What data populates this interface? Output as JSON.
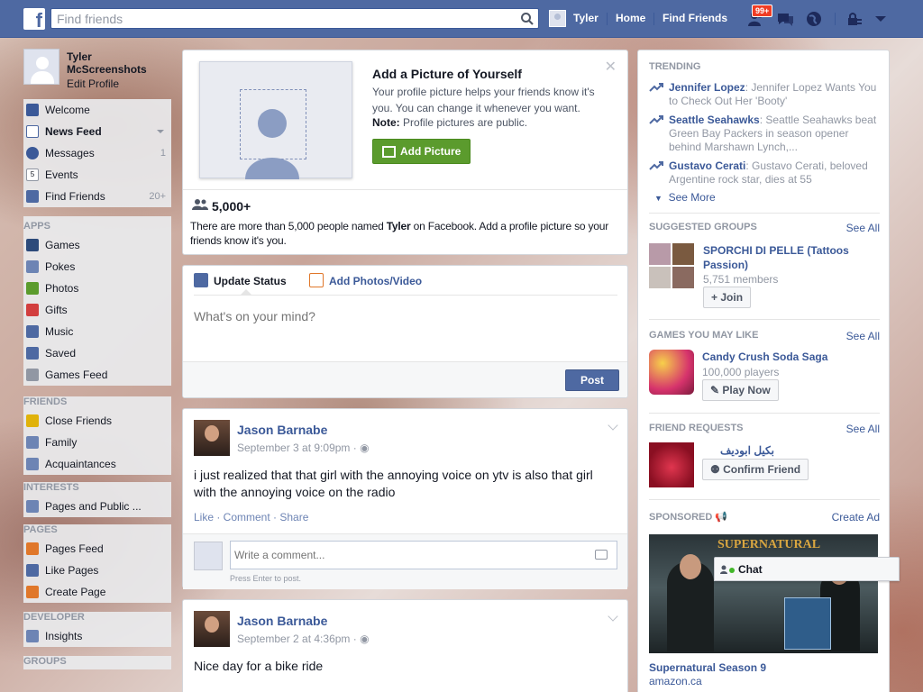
{
  "topbar": {
    "search_placeholder": "Find friends",
    "user": "Tyler",
    "home": "Home",
    "find_friends": "Find Friends",
    "notifications_badge": "99+"
  },
  "left": {
    "name": "Tyler McScreenshots",
    "edit_profile": "Edit Profile",
    "favorites": [
      {
        "label": "Welcome",
        "count": "",
        "icon": "facebook-icon",
        "color": "#3b5998"
      },
      {
        "label": "News Feed",
        "count": "",
        "icon": "news-feed-icon",
        "color": "#4e69a2"
      },
      {
        "label": "Messages",
        "count": "1",
        "icon": "messages-icon",
        "color": "#3b5998"
      },
      {
        "label": "Events",
        "count": "",
        "icon": "calendar-icon",
        "color": "#ffffff"
      },
      {
        "label": "Find Friends",
        "count": "20+",
        "icon": "find-friends-icon",
        "color": "#4e69a2"
      }
    ],
    "apps_heading": "APPS",
    "apps": [
      {
        "label": "Games",
        "icon": "games-icon",
        "color": "#2d4a7a"
      },
      {
        "label": "Pokes",
        "icon": "pokes-icon",
        "color": "#6d84b4"
      },
      {
        "label": "Photos",
        "icon": "photos-icon",
        "color": "#5b9b2d"
      },
      {
        "label": "Gifts",
        "icon": "gift-icon",
        "color": "#d23e3e"
      },
      {
        "label": "Music",
        "icon": "music-icon",
        "color": "#4e69a2"
      },
      {
        "label": "Saved",
        "icon": "saved-icon",
        "color": "#4e69a2"
      },
      {
        "label": "Games Feed",
        "icon": "gamepad-icon",
        "color": "#9197a3"
      }
    ],
    "friends_heading": "FRIENDS",
    "friends": [
      {
        "label": "Close Friends",
        "icon": "star-icon",
        "color": "#e0b20a"
      },
      {
        "label": "Family",
        "icon": "house-icon",
        "color": "#6d84b4"
      },
      {
        "label": "Acquaintances",
        "icon": "acquaintances-icon",
        "color": "#6d84b4"
      }
    ],
    "interests_heading": "INTERESTS",
    "interests": [
      {
        "label": "Pages and Public ...",
        "icon": "rss-icon",
        "color": "#6d84b4"
      }
    ],
    "pages_heading": "PAGES",
    "pages": [
      {
        "label": "Pages Feed",
        "icon": "megaphone-icon",
        "color": "#e0772a"
      },
      {
        "label": "Like Pages",
        "icon": "like-icon",
        "color": "#4e69a2"
      },
      {
        "label": "Create Page",
        "icon": "create-page-icon",
        "color": "#e0772a"
      }
    ],
    "developer_heading": "DEVELOPER",
    "developer": [
      {
        "label": "Insights",
        "icon": "insights-icon",
        "color": "#6d84b4"
      }
    ],
    "groups_heading": "GROUPS"
  },
  "profile_prompt": {
    "title": "Add a Picture of Yourself",
    "text": "Your profile picture helps your friends know it's you. You can change it whenever you want.",
    "note_label": "Note:",
    "note_text": "Profile pictures are public.",
    "button": "Add Picture",
    "count": "5,000+",
    "desc_prefix": "There are more than 5,000 people named",
    "desc_name": "Tyler",
    "desc_suffix": "on Facebook. Add a profile picture so your friends know it's you."
  },
  "composer": {
    "tab_status": "Update Status",
    "tab_photos": "Add Photos/Video",
    "placeholder": "What's on your mind?",
    "post": "Post"
  },
  "stories": [
    {
      "author": "Jason Barnabe",
      "time": "September 3 at 9:09pm",
      "text": "i just realized that that girl with the annoying voice on ytv is also that girl with the annoying voice on the radio",
      "actions": "Like · Comment · Share",
      "comment_placeholder": "Write a comment...",
      "hint": "Press Enter to post."
    },
    {
      "author": "Jason Barnabe",
      "time": "September 2 at 4:36pm",
      "text": "Nice day for a bike ride"
    }
  ],
  "right": {
    "trending_heading": "TRENDING",
    "trending": [
      {
        "name": "Jennifer Lopez",
        "text": ": Jennifer Lopez Wants You to Check Out Her 'Booty'"
      },
      {
        "name": "Seattle Seahawks",
        "text": ": Seattle Seahawks beat Green Bay Packers in season opener behind Marshawn Lynch,..."
      },
      {
        "name": "Gustavo Cerati",
        "text": ": Gustavo Cerati, beloved Argentine rock star, dies at 55"
      }
    ],
    "see_more": "See More",
    "groups_heading": "SUGGESTED GROUPS",
    "see_all": "See All",
    "group_name": "SPORCHI DI PELLE (Tattoos Passion)",
    "group_members": "5,751 members",
    "join": "Join",
    "games_heading": "GAMES YOU MAY LIKE",
    "game_name": "Candy Crush Soda Saga",
    "game_players": "100,000 players",
    "play_now": "Play Now",
    "requests_heading": "FRIEND REQUESTS",
    "request_name": "بكيل ابوديف",
    "confirm": "Confirm Friend",
    "sponsored_heading": "SPONSORED",
    "create_ad": "Create Ad",
    "ad_image_text": "SUPERNATURAL",
    "ad_title": "Supernatural Season 9",
    "ad_domain": "amazon.ca"
  },
  "chat": {
    "label": "Chat"
  }
}
